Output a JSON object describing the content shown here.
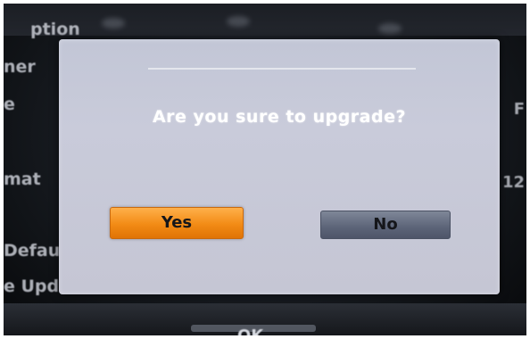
{
  "background": {
    "menu_items": [
      {
        "label": "ption"
      },
      {
        "label": "ner"
      },
      {
        "label": "e"
      },
      {
        "label": "mat"
      },
      {
        "label": "Defau"
      },
      {
        "label": "e Update"
      }
    ],
    "right_values": [
      "F",
      "12"
    ],
    "ok_label": "OK"
  },
  "dialog": {
    "message": "Are you sure to upgrade?",
    "yes_label": "Yes",
    "no_label": "No"
  },
  "colors": {
    "yes_button": "#f28b15",
    "no_button": "#5c6478",
    "dialog_bg": "#c6c8d7"
  }
}
